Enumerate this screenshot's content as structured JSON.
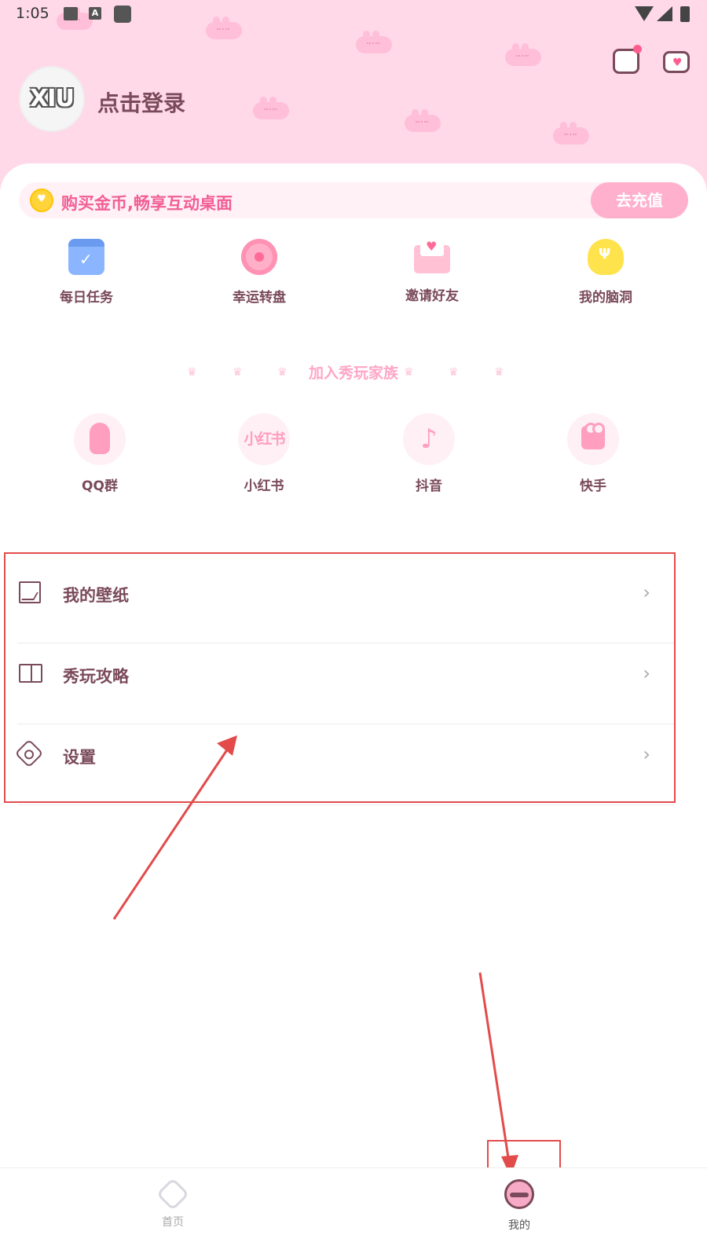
{
  "status_bar": {
    "time": "1:05",
    "a_icon_label": "A"
  },
  "header": {
    "avatar_text": "XIU",
    "login_label": "点击登录"
  },
  "banner": {
    "text": "购买金币,畅享互动桌面",
    "button_label": "去充值"
  },
  "quick_actions": [
    {
      "label": "每日任务",
      "icon": "calendar-check-icon"
    },
    {
      "label": "幸运转盘",
      "icon": "lucky-wheel-icon"
    },
    {
      "label": "邀请好友",
      "icon": "envelope-heart-icon"
    },
    {
      "label": "我的脑洞",
      "icon": "lightbulb-icon"
    }
  ],
  "join_section": {
    "title": "加入秀玩家族"
  },
  "social_links": [
    {
      "label": "QQ群",
      "icon": "qq-penguin-icon"
    },
    {
      "label": "小红书",
      "icon": "xiaohongshu-icon",
      "glyph": "小红书"
    },
    {
      "label": "抖音",
      "icon": "douyin-icon",
      "glyph": "♪"
    },
    {
      "label": "快手",
      "icon": "kuaishou-icon"
    }
  ],
  "menu": [
    {
      "label": "我的壁纸",
      "icon": "picture-icon"
    },
    {
      "label": "秀玩攻略",
      "icon": "book-icon"
    },
    {
      "label": "设置",
      "icon": "gear-icon"
    }
  ],
  "bottom_nav": [
    {
      "label": "首页",
      "icon": "home-diamond-icon",
      "active": false
    },
    {
      "label": "我的",
      "icon": "mine-face-icon",
      "active": true
    }
  ],
  "colors": {
    "accent": "#f25f95",
    "header_bg": "#ffd9e8",
    "text": "#7a4a5a",
    "annotation": "#e34b4b"
  }
}
